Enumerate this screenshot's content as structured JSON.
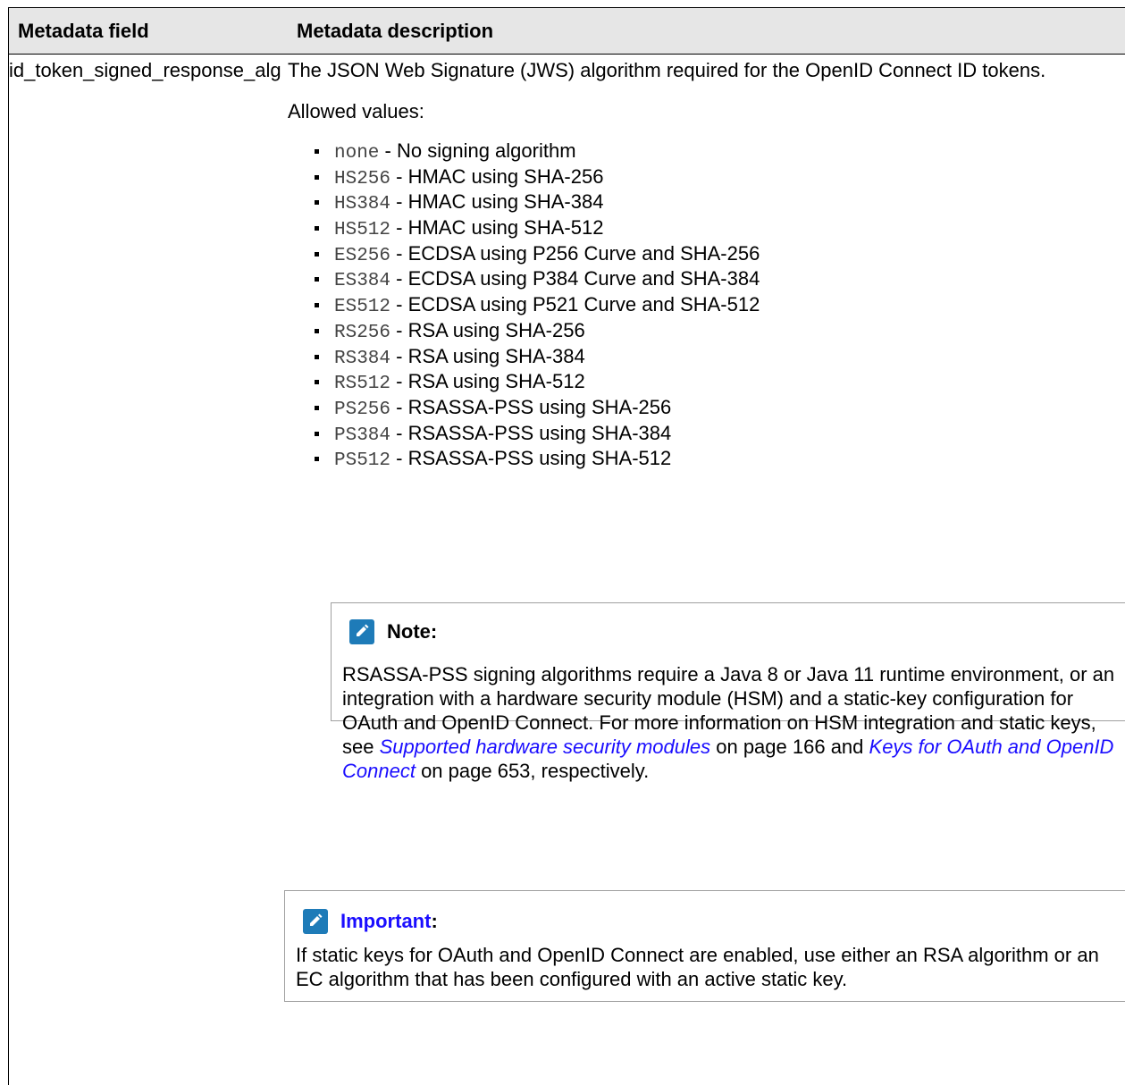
{
  "table": {
    "headers": [
      "Metadata field",
      "Metadata description"
    ],
    "field_name": "id_token_signed_response_alg",
    "description": "The JSON Web Signature (JWS) algorithm required for the OpenID Connect ID tokens.",
    "allowed_label": "Allowed values:",
    "algorithms": [
      {
        "code": "none",
        "text": " - No signing algorithm"
      },
      {
        "code": "HS256",
        "text": " - HMAC using SHA-256"
      },
      {
        "code": "HS384",
        "text": " - HMAC using SHA-384"
      },
      {
        "code": "HS512",
        "text": " - HMAC using SHA-512"
      },
      {
        "code": "ES256",
        "text": " - ECDSA using P256 Curve and SHA-256"
      },
      {
        "code": "ES384",
        "text": " - ECDSA using P384 Curve and SHA-384"
      },
      {
        "code": "ES512",
        "text": " - ECDSA using P521 Curve and SHA-512"
      },
      {
        "code": "RS256",
        "text": " - RSA using SHA-256"
      },
      {
        "code": "RS384",
        "text": " - RSA using SHA-384"
      },
      {
        "code": "RS512",
        "text": " - RSA using SHA-512"
      },
      {
        "code": "PS256",
        "text": " - RSASSA-PSS using SHA-256"
      },
      {
        "code": "PS384",
        "text": " - RSASSA-PSS using SHA-384"
      },
      {
        "code": "PS512",
        "text": " - RSASSA-PSS using SHA-512"
      }
    ]
  },
  "note": {
    "title": "Note:",
    "text_1": "RSASSA-PSS signing algorithms require a Java 8 or Java 11 runtime environment, or an integration with a hardware security module (HSM) and a static-key configuration for OAuth and OpenID Connect. For more information on HSM integration and static keys, see ",
    "link_1": "Supported hardware security modules",
    "text_2": " on page 166 and ",
    "link_2": "Keys for OAuth and OpenID Connect",
    "text_3": " on page 653, respectively."
  },
  "important": {
    "title_link": "Important",
    "title_suffix": ":",
    "text": "If static keys for OAuth and OpenID Connect are enabled, use either an RSA algorithm or an EC algorithm that has been configured with an active static key."
  },
  "colors": {
    "header_bg": "#e6e6e6",
    "icon_bg": "#1e7bb8",
    "link": "#1a0dff"
  },
  "icons": [
    "pencil-icon"
  ]
}
